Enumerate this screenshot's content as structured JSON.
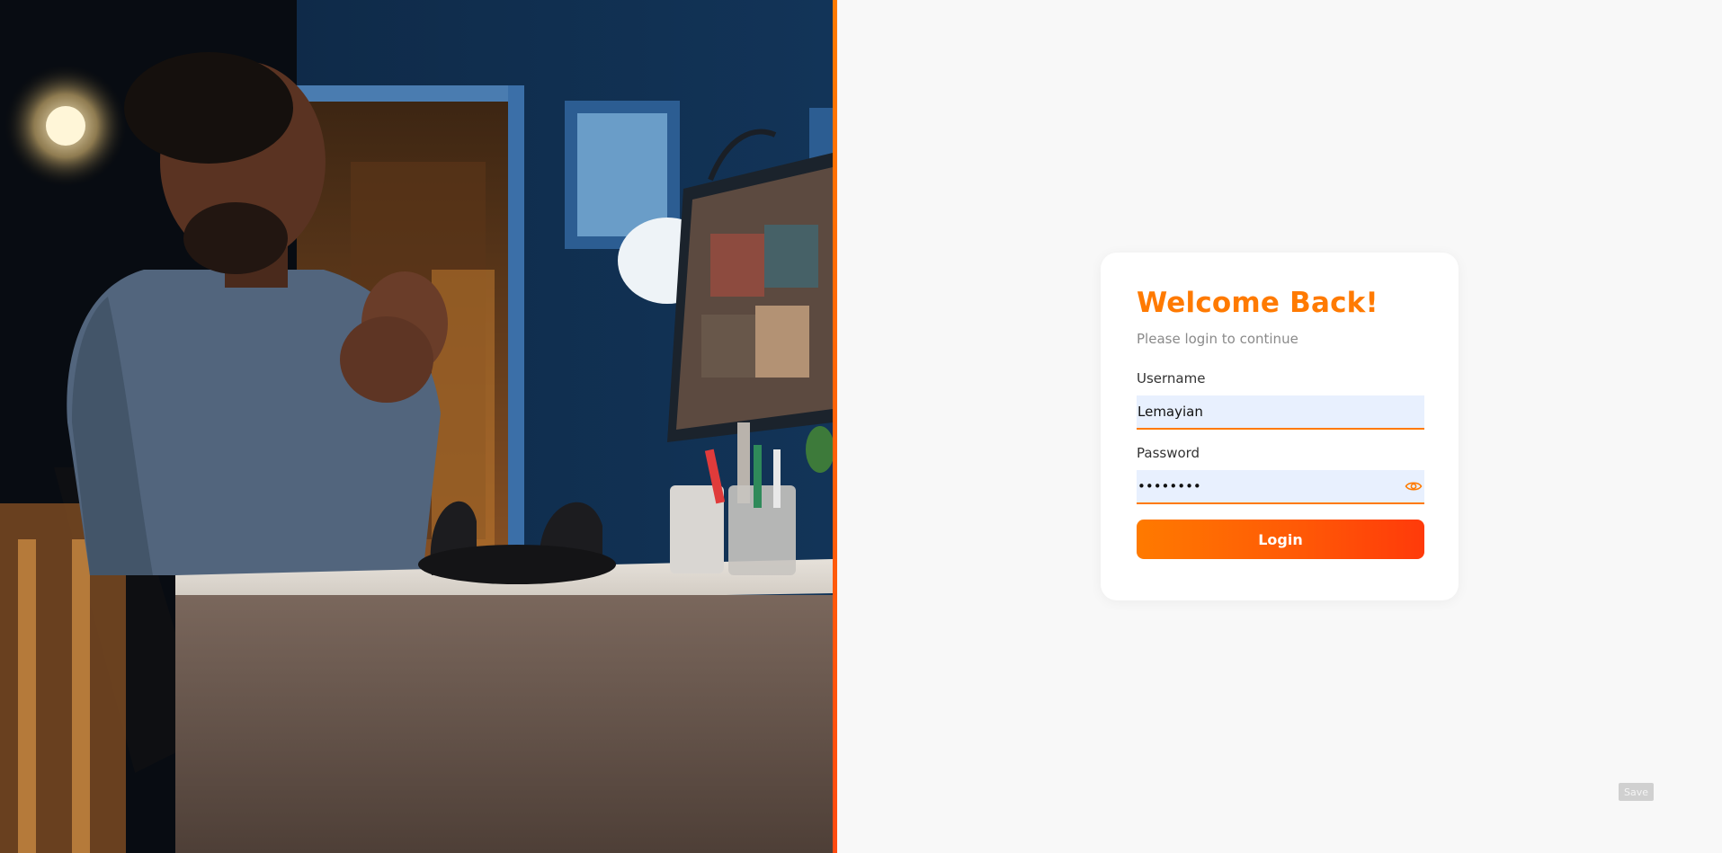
{
  "login": {
    "title": "Welcome Back!",
    "subtitle": "Please login to continue",
    "username_label": "Username",
    "username_value": "Lemayian",
    "password_label": "Password",
    "password_value": "••••••••",
    "password_toggle_icon": "eye-icon",
    "login_button": "Login"
  },
  "save_button": "Save",
  "colors": {
    "accent": "#ff7a00",
    "accent_end": "#ff3a0a",
    "input_bg": "#e8f0fe",
    "page_bg": "#f8f8f8"
  }
}
